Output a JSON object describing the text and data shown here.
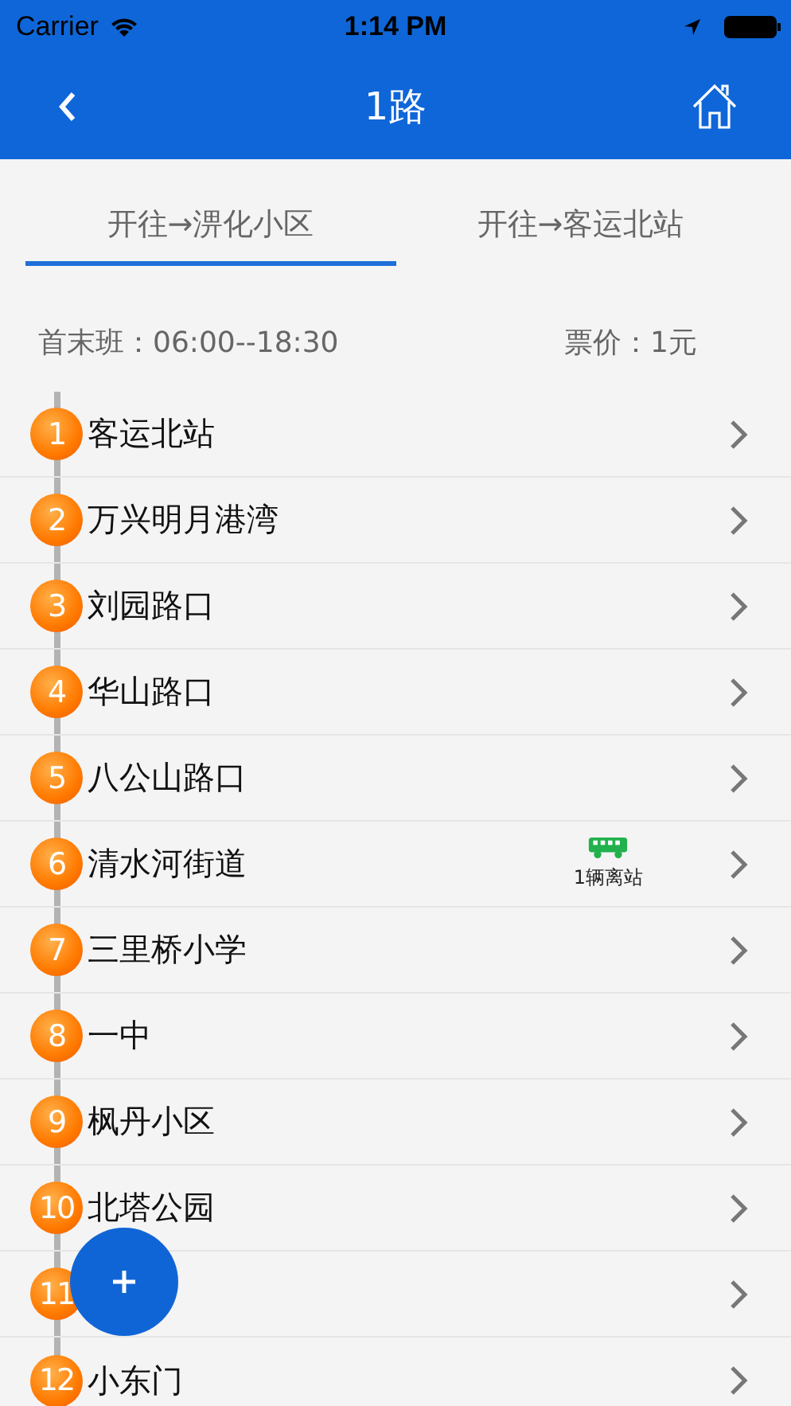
{
  "status_bar": {
    "carrier": "Carrier",
    "time": "1:14 PM"
  },
  "nav": {
    "title": "1路"
  },
  "tabs": [
    {
      "label": "开往→淠化小区",
      "selected": true
    },
    {
      "label": "开往→客运北站",
      "selected": false
    }
  ],
  "info": {
    "hours": "首末班：06:00--18:30",
    "fare": "票价：1元"
  },
  "stations": [
    {
      "number": "1",
      "name": "客运北站"
    },
    {
      "number": "2",
      "name": "万兴明月港湾"
    },
    {
      "number": "3",
      "name": "刘园路口"
    },
    {
      "number": "4",
      "name": "华山路口"
    },
    {
      "number": "5",
      "name": "八公山路口"
    },
    {
      "number": "6",
      "name": "清水河街道",
      "bus": {
        "label": "1辆离站"
      }
    },
    {
      "number": "7",
      "name": "三里桥小学"
    },
    {
      "number": "8",
      "name": "一中"
    },
    {
      "number": "9",
      "name": "枫丹小区"
    },
    {
      "number": "10",
      "name": "北塔公园"
    },
    {
      "number": "11"
    },
    {
      "number": "12",
      "name": "小东门"
    }
  ]
}
